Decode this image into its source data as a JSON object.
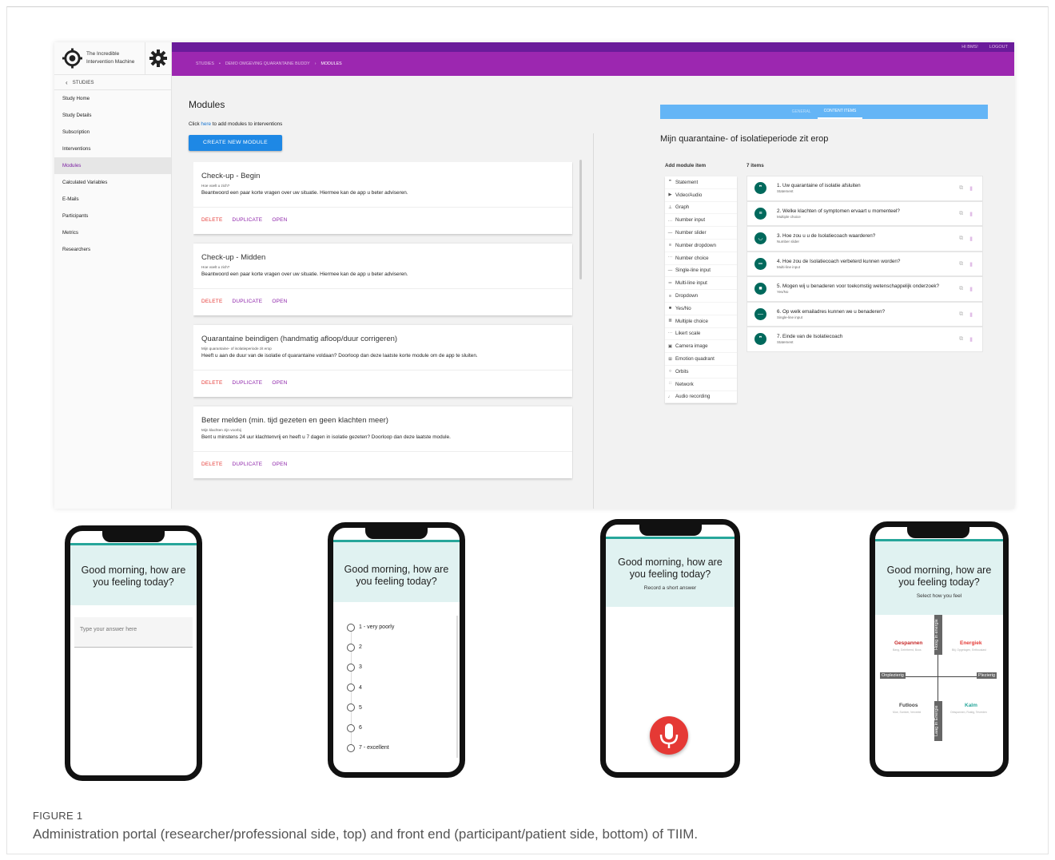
{
  "portal": {
    "app_title": "The Incredible Intervention Machine",
    "back_label": "STUDIES",
    "nav": [
      "Study Home",
      "Study Details",
      "Subscription",
      "Interventions",
      "Modules",
      "Calculated Variables",
      "E-Mails",
      "Participants",
      "Metrics",
      "Researchers"
    ],
    "active_nav": "Modules",
    "user": "HI BMS!",
    "logout": "LOGOUT",
    "breadcrumbs": [
      "STUDIES",
      "DEMO OMGEVING QUARANTAINE BUDDY",
      "MODULES"
    ],
    "title": "Modules",
    "hint_pre": "Click ",
    "hint_link": "here",
    "hint_post": " to add modules to interventions",
    "create_button": "CREATE NEW MODULE",
    "modules": [
      {
        "title": "Check-up - Begin",
        "subtitle": "Hoe voelt u zich?",
        "desc": "Beantwoord een paar korte vragen over uw situatie. Hiermee kan de app u beter adviseren."
      },
      {
        "title": "Check-up - Midden",
        "subtitle": "Hoe voelt u zich?",
        "desc": "Beantwoord een paar korte vragen over uw situatie. Hiermee kan de app u beter adviseren."
      },
      {
        "title": "Quarantaine beindigen (handmatig afloop/duur corrigeren)",
        "subtitle": "Mijn quarantaine- of isolatieperiode zit erop",
        "desc": "Heeft u aan de duur van de isolatie of quarantaine voldaan? Doorloop dan deze laatste korte module om de app te sluiten."
      },
      {
        "title": "Beter melden (min. tijd gezeten en geen klachten meer)",
        "subtitle": "Mijn klachten zijn voorbij",
        "desc": "Bent u minstens 24 uur klachtenvrij en heeft u 7 dagen in isolatie gezeten? Doorloop dan deze laatste module."
      }
    ],
    "actions": {
      "delete": "DELETE",
      "duplicate": "DUPLICATE",
      "open": "OPEN"
    },
    "tabs": [
      "GENERAL",
      "CONTENT ITEMS"
    ],
    "active_tab": "CONTENT ITEMS",
    "module_title": "Mijn quarantaine- of isolatieperiode zit erop",
    "add_item_header": "Add module item",
    "count_header": "7 items",
    "item_types": [
      {
        "icon": "quote-icon",
        "glyph": "❞",
        "label": "Statement"
      },
      {
        "icon": "play-icon",
        "glyph": "▶",
        "label": "Video/Audio"
      },
      {
        "icon": "graph-icon",
        "glyph": "⊥",
        "label": "Graph"
      },
      {
        "icon": "number-input-icon",
        "glyph": "…",
        "label": "Number input"
      },
      {
        "icon": "slider-icon",
        "glyph": "—",
        "label": "Number slider"
      },
      {
        "icon": "dropdown-icon",
        "glyph": "≡",
        "label": "Number dropdown"
      },
      {
        "icon": "choice-icon",
        "glyph": "⋯",
        "label": "Number choice"
      },
      {
        "icon": "single-line-icon",
        "glyph": "—",
        "label": "Single-line input"
      },
      {
        "icon": "multi-line-icon",
        "glyph": "═",
        "label": "Multi-line input"
      },
      {
        "icon": "list-icon",
        "glyph": "≡",
        "label": "Dropdown"
      },
      {
        "icon": "yes-no-icon",
        "glyph": "■",
        "label": "Yes/No"
      },
      {
        "icon": "multiple-choice-icon",
        "glyph": "≣",
        "label": "Multiple choice"
      },
      {
        "icon": "likert-icon",
        "glyph": "⋯",
        "label": "Likert scale"
      },
      {
        "icon": "camera-icon",
        "glyph": "▣",
        "label": "Camera image"
      },
      {
        "icon": "quadrant-icon",
        "glyph": "⊞",
        "label": "Emotion quadrant"
      },
      {
        "icon": "orbits-icon",
        "glyph": "○",
        "label": "Orbits"
      },
      {
        "icon": "network-icon",
        "glyph": "∷",
        "label": "Network"
      },
      {
        "icon": "mic-icon",
        "glyph": "♩",
        "label": "Audio recording"
      }
    ],
    "content_items": [
      {
        "glyph": "❞",
        "title": "1. Uw quarantaine of isolatie afsluiten",
        "type": "Statement"
      },
      {
        "glyph": "≡",
        "title": "2. Welke klachten of symptomen ervaart u momenteel?",
        "type": "Multiple choice"
      },
      {
        "glyph": "◡",
        "title": "3. Hoe zou u u de Isolatiecoach waarderen?",
        "type": "Number slider"
      },
      {
        "glyph": "═",
        "title": "4. Hoe zou de Isolatiecoach verbeterd kunnen worden?",
        "type": "Multi-line input"
      },
      {
        "glyph": "■",
        "title": "5. Mogen wij u benaderen voor toekomstig wetenschappelijk onderzoek?",
        "type": "Yes/No"
      },
      {
        "glyph": "—",
        "title": "6. Op welk emailadres kunnen we u benaderen?",
        "type": "Single-line input"
      },
      {
        "glyph": "❞",
        "title": "7. Einde van de Isolatiecoach",
        "type": "Statement"
      }
    ]
  },
  "phones": {
    "question": "Good morning, how are you feeling today?",
    "text_placeholder": "Type your answer here",
    "scale_options": [
      "1 - very poorly",
      "2",
      "3",
      "4",
      "5",
      "6",
      "7 - excellent"
    ],
    "record_sub": "Record a short answer",
    "quadrant_sub": "Select how you feel",
    "quadrant": {
      "tl": "Gespannen",
      "tl_sub": "Bang, Geïrriteerd, Boos",
      "tr": "Energiek",
      "tr_sub": "Blij, Opgetogen, Enthousiast",
      "bl": "Futloos",
      "bl_sub": "Moe, Somber, Verveeld",
      "br": "Kalm",
      "br_sub": "Ontspannen, Rustig, Tevreden",
      "left": "Onplezierig",
      "right": "Plezierig",
      "top": "Hoog in energie",
      "bottom": "Laag in Energie",
      "colors": {
        "tl": "#c62828",
        "tr": "#e53935",
        "bl": "#444444",
        "br": "#26a69a"
      }
    }
  },
  "caption": {
    "label": "FIGURE 1",
    "text": "Administration portal (researcher/professional side, top) and front end (participant/patient side, bottom) of TIIM."
  }
}
